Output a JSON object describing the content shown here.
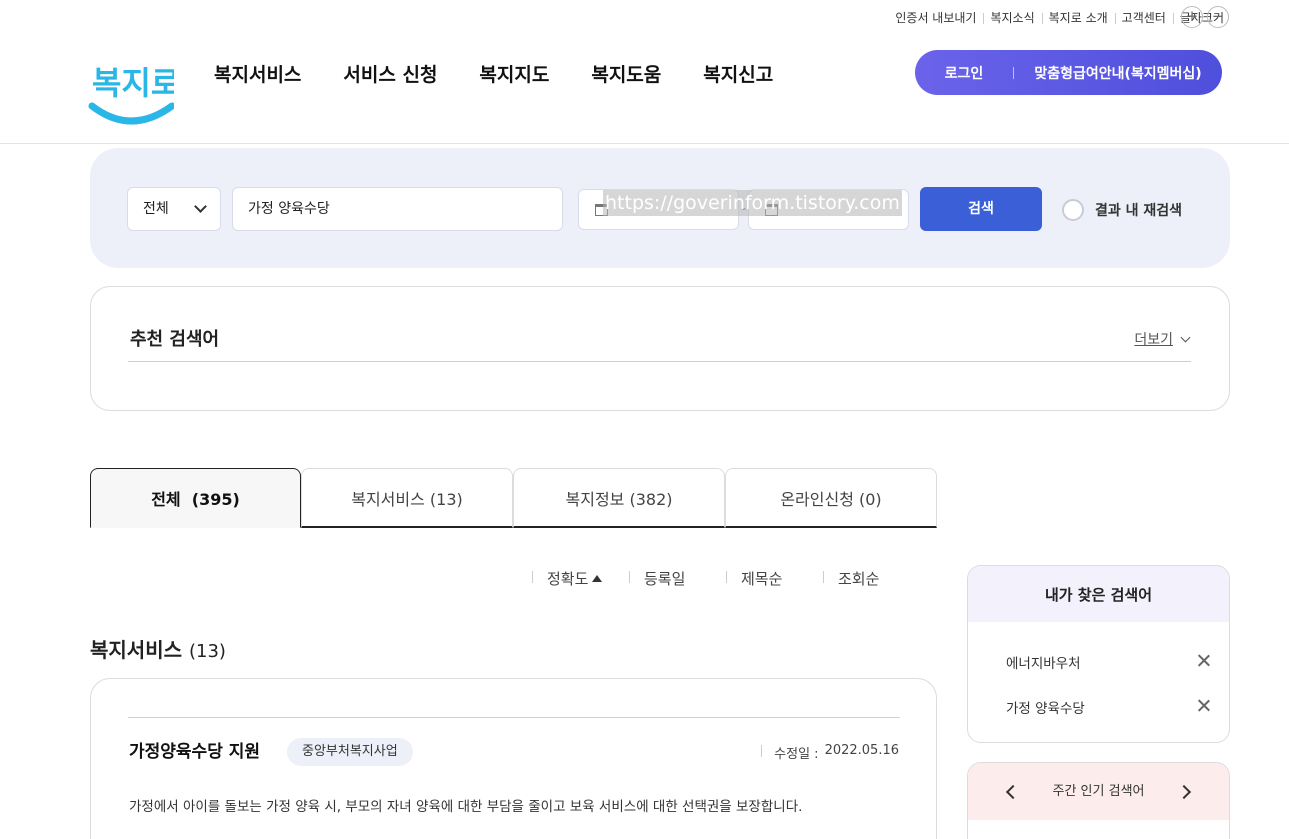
{
  "utility": {
    "items": [
      "인증서 내보내기",
      "복지소식",
      "복지로 소개",
      "고객센터",
      "글자크기"
    ],
    "font_plus": "+",
    "font_minus": "−"
  },
  "logo": {
    "text": "복지로",
    "color": "#2bb6e8"
  },
  "gnb": [
    "복지서비스",
    "서비스 신청",
    "복지지도",
    "복지도움",
    "복지신고"
  ],
  "login_pill": {
    "login": "로그인",
    "membership": "맞춤형급여안내(복지멤버십)"
  },
  "search": {
    "category": "전체",
    "keyword": "가정 양육수당",
    "date_sep": "-",
    "watermark": "https://goverinform.tistory.com",
    "button": "검색",
    "re_search": "결과 내 재검색"
  },
  "recommended": {
    "title": "추천 검색어",
    "more": "더보기"
  },
  "tabs": [
    {
      "label": "전체  (395)",
      "active": true
    },
    {
      "label": "복지서비스 (13)",
      "active": false
    },
    {
      "label": "복지정보 (382)",
      "active": false
    },
    {
      "label": "온라인신청 (0)",
      "active": false
    }
  ],
  "sort": [
    "정확도",
    "등록일",
    "제목순",
    "조회순"
  ],
  "section": {
    "title": "복지서비스",
    "count": "(13)"
  },
  "result": {
    "title": "가정양육수당 지원",
    "badge": "중앙부처복지사업",
    "date_label": "수정일 :",
    "date_value": "2022.05.16",
    "desc": "가정에서 아이를 돌보는 가정 양육 시, 부모의 자녀 양육에 대한 부담을 줄이고 보육 서비스에 대한 선택권을 보장합니다."
  },
  "my_keywords": {
    "title": "내가 찾은 검색어",
    "items": [
      "에너지바우처",
      "가정 양육수당"
    ]
  },
  "weekly": {
    "title": "주간 인기 검색어"
  },
  "colors": {
    "accent": "#3a5fd7",
    "pill": "#5a58e2",
    "logo": "#2bb6e8"
  }
}
